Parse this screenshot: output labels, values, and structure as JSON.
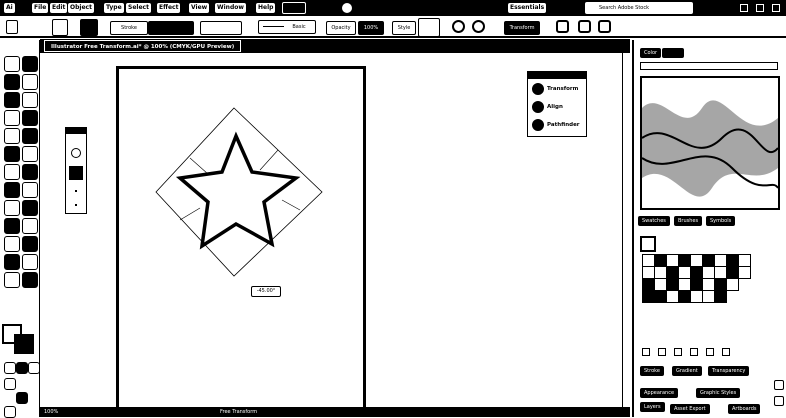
{
  "menubar": {
    "logo": "Ai",
    "items": [
      "File",
      "Edit",
      "Object",
      "Type",
      "Select",
      "Effect",
      "View",
      "Window",
      "Help"
    ],
    "workspace": "Essentials",
    "search_placeholder": "Search Adobe Stock"
  },
  "controlbar": {
    "stroke_label": "Stroke",
    "basic_label": "Basic",
    "opacity_label": "Opacity",
    "opacity_value": "100%",
    "style_label": "Style",
    "transform_label": "Transform"
  },
  "document": {
    "tab_title": "Illustrator Free Transform.ai* @ 100% (CMYK/GPU Preview)",
    "rotate_readout": "-45.00°",
    "zoom": "100%",
    "status_tool": "Free Transform"
  },
  "float_panel": {
    "rows": [
      "Transform",
      "Align",
      "Pathfinder"
    ]
  },
  "right_panel": {
    "top_tabs": [
      "Color",
      "Color Guide"
    ],
    "mid_tabs": [
      "Swatches",
      "Brushes",
      "Symbols"
    ],
    "lower_tabs": [
      "Stroke",
      "Gradient",
      "Transparency"
    ],
    "bottom_tabs": [
      "Appearance",
      "Graphic Styles",
      "Layers",
      "Asset Export",
      "Artboards"
    ]
  },
  "colors": {
    "ui_dark": "#000000",
    "ui_light": "#ffffff"
  }
}
